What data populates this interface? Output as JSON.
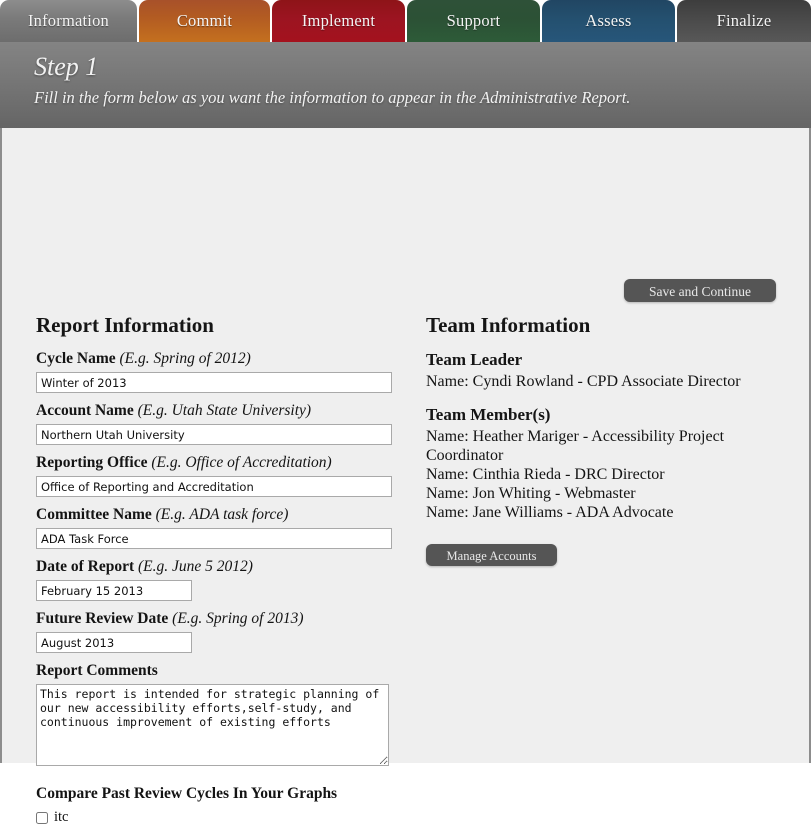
{
  "tabs": [
    {
      "id": "information",
      "label": "Information",
      "active": true,
      "color": "#7a7a7a"
    },
    {
      "id": "commit",
      "label": "Commit",
      "active": false,
      "color": "#b25b22"
    },
    {
      "id": "implement",
      "label": "Implement",
      "active": false,
      "color": "#9c1421"
    },
    {
      "id": "support",
      "label": "Support",
      "active": false,
      "color": "#2c5135"
    },
    {
      "id": "assess",
      "label": "Assess",
      "active": false,
      "color": "#24506f"
    },
    {
      "id": "finalize",
      "label": "Finalize",
      "active": false,
      "color": "#4a4a4a"
    }
  ],
  "header": {
    "step_title": "Step 1",
    "subtitle": "Fill in the form below as you want the information to appear in the Administrative Report.",
    "background_color": "#7c7c7c"
  },
  "toolbar": {
    "save_continue_label": "Save and Continue"
  },
  "report_information": {
    "section_title": "Report Information",
    "fields": [
      {
        "name": "cycle-name",
        "label": "Cycle Name",
        "hint": "(E.g. Spring of 2012)",
        "value": "Winter of 2013",
        "placeholder": ""
      },
      {
        "name": "account-name",
        "label": "Account Name",
        "hint": "(E.g. Utah State University)",
        "value": "Northern Utah University",
        "placeholder": ""
      },
      {
        "name": "reporting-office",
        "label": "Reporting Office",
        "hint": "(E.g. Office of Accreditation)",
        "value": "Office of Reporting and Accreditation",
        "placeholder": ""
      },
      {
        "name": "committee-name",
        "label": "Committee Name",
        "hint": "(E.g. ADA task force)",
        "value": "ADA Task Force",
        "placeholder": ""
      },
      {
        "name": "date-of-report",
        "label": "Date of Report",
        "hint": "(E.g. June 5 2012)",
        "value": "February 15 2013",
        "placeholder": ""
      },
      {
        "name": "future-review-date",
        "label": "Future Review Date",
        "hint": "(E.g. Spring of 2013)",
        "value": "August 2013",
        "placeholder": ""
      }
    ],
    "comments": {
      "label": "Report Comments",
      "value": "This report is intended for strategic planning of our new accessibility efforts,self-study, and continuous improvement of existing efforts",
      "placeholder": ""
    },
    "compare": {
      "label": "Compare Past Review Cycles In Your Graphs",
      "options": [
        {
          "label": "itc",
          "checked": false
        }
      ]
    }
  },
  "team_information": {
    "section_title": "Team Information",
    "leader": {
      "heading": "Team Leader",
      "line": "Name: Cyndi Rowland - CPD Associate Director"
    },
    "members": {
      "heading": "Team Member(s)",
      "lines": [
        "Name: Heather Mariger - Accessibility Project Coordinator",
        "Name: Cinthia Rieda - DRC Director",
        "Name: Jon Whiting - Webmaster",
        "Name: Jane Williams - ADA Advocate"
      ]
    },
    "manage_accounts_label": "Manage Accounts"
  }
}
